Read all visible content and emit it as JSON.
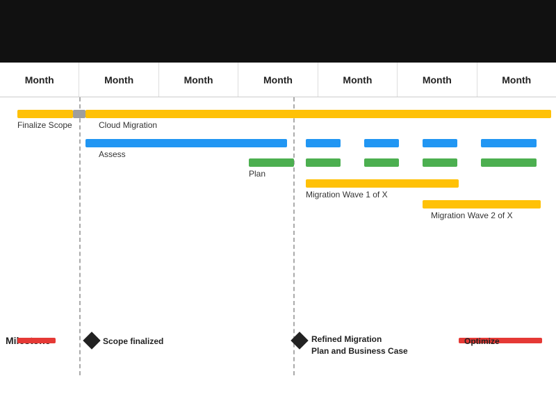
{
  "topBar": {
    "color": "#111"
  },
  "months": [
    {
      "label": "Month",
      "id": "m1"
    },
    {
      "label": "Month",
      "id": "m2"
    },
    {
      "label": "Month",
      "id": "m3"
    },
    {
      "label": "Month",
      "id": "m4"
    },
    {
      "label": "Month",
      "id": "m5"
    },
    {
      "label": "Month",
      "id": "m6"
    },
    {
      "label": "Month",
      "id": "m7"
    }
  ],
  "colors": {
    "orange": "#FFC107",
    "blue": "#2196F3",
    "green": "#4CAF50",
    "gray": "#9E9E9E",
    "red": "#E53935",
    "dark": "#212121"
  },
  "labels": {
    "finalizeScope": "Finalize Scope",
    "cloudMigration": "Cloud Migration",
    "assess": "Assess",
    "plan": "Plan",
    "migrationWave1": "Migration Wave 1 of X",
    "migrationWave2": "Migration Wave 2 of X",
    "milestone": "Milestone",
    "scopeFinalized": "Scope finalized",
    "refinedMigration": "Refined Migration Plan and Business Case",
    "optimize": "Optimize"
  }
}
